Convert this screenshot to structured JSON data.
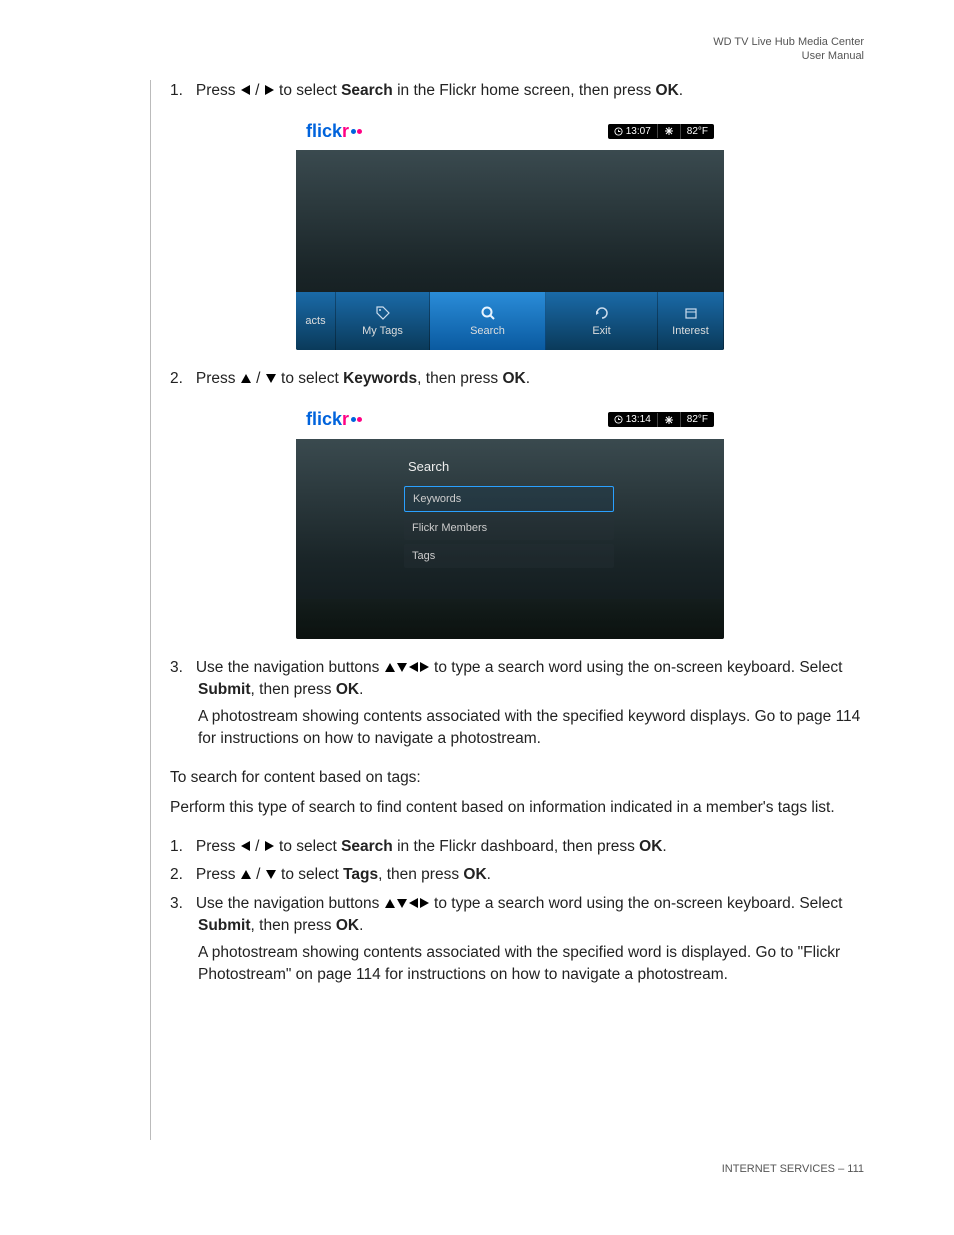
{
  "header": {
    "line1": "WD TV Live Hub Media Center",
    "line2": "User Manual"
  },
  "steps1": {
    "s1_num": "1.",
    "s1_a": "Press ",
    "s1_b": " to select ",
    "s1_bold1": "Search",
    "s1_c": " in the Flickr home screen, then press ",
    "s1_bold2": "OK",
    "s1_d": ".",
    "s2_num": "2.",
    "s2_a": "Press ",
    "s2_b": " to select ",
    "s2_bold1": "Keywords",
    "s2_c": ", then press ",
    "s2_bold2": "OK",
    "s2_d": ".",
    "s3_num": "3.",
    "s3_a": "Use the navigation buttons ",
    "s3_b": " to type a search word using the on-screen keyboard. Select ",
    "s3_bold1": "Submit",
    "s3_c": ", then press ",
    "s3_bold2": "OK",
    "s3_d": ".",
    "s3_sub": "A photostream showing contents associated with the specified keyword displays. Go to page 114 for instructions on how to navigate a photostream."
  },
  "intro2": "To search for content based on tags:",
  "desc2": "Perform this type of search to find content based on information indicated in a member's tags list.",
  "steps2": {
    "s1_num": "1.",
    "s1_a": "Press ",
    "s1_b": " to select ",
    "s1_bold1": "Search",
    "s1_c": " in the Flickr dashboard, then press ",
    "s1_bold2": "OK",
    "s1_d": ".",
    "s2_num": "2.",
    "s2_a": "Press ",
    "s2_b": " to select ",
    "s2_bold1": "Tags",
    "s2_c": ", then press ",
    "s2_bold2": "OK",
    "s2_d": ".",
    "s3_num": "3.",
    "s3_a": "Use the navigation buttons ",
    "s3_b": " to type a search word using the on-screen keyboard. Select ",
    "s3_bold1": "Submit",
    "s3_c": ", then press ",
    "s3_bold2": "OK",
    "s3_d": ".",
    "s3_sub": "A photostream showing contents associated with the specified word is displayed. Go to \"Flickr Photostream\" on page 114 for instructions on how to navigate a photostream."
  },
  "ss1": {
    "logo_flick": "flick",
    "logo_r": "r",
    "time": "13:07",
    "temp": "82°F",
    "nav": {
      "acts": "acts",
      "mytags": "My Tags",
      "search": "Search",
      "exit": "Exit",
      "interest": "Interest"
    }
  },
  "ss2": {
    "logo_flick": "flick",
    "logo_r": "r",
    "time": "13:14",
    "temp": "82°F",
    "title": "Search",
    "opt1": "Keywords",
    "opt2": "Flickr Members",
    "opt3": "Tags"
  },
  "footer": {
    "label": "INTERNET SERVICES",
    "dash": " – ",
    "page": "111"
  },
  "glyph": {
    "slash": " / "
  }
}
